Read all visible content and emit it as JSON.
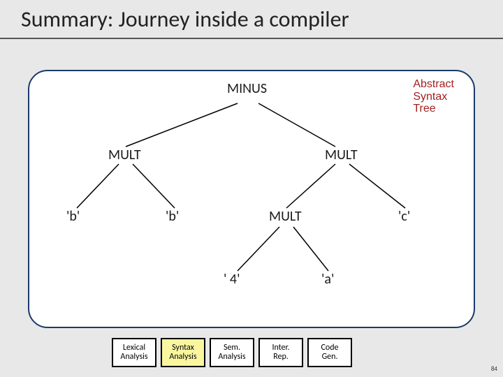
{
  "title": "Summary: Journey inside a compiler",
  "caption_line1": "Abstract",
  "caption_line2": "Syntax",
  "caption_line3": "Tree",
  "tree": {
    "root": "MINUS",
    "left": {
      "label": "MULT",
      "leaves": {
        "a": "'b'",
        "b": "'b'"
      }
    },
    "right": {
      "label": "MULT",
      "left": {
        "label": "MULT",
        "leaves": {
          "a": "' 4'",
          "b": "'a'"
        }
      },
      "right_leaf": "'c'"
    }
  },
  "stages": [
    {
      "l1": "Lexical",
      "l2": "Analysis",
      "hl": false
    },
    {
      "l1": "Syntax",
      "l2": "Analysis",
      "hl": true
    },
    {
      "l1": "Sem.",
      "l2": "Analysis",
      "hl": false
    },
    {
      "l1": "Inter.",
      "l2": "Rep.",
      "hl": false
    },
    {
      "l1": "Code",
      "l2": "Gen.",
      "hl": false
    }
  ],
  "page_number": "84"
}
